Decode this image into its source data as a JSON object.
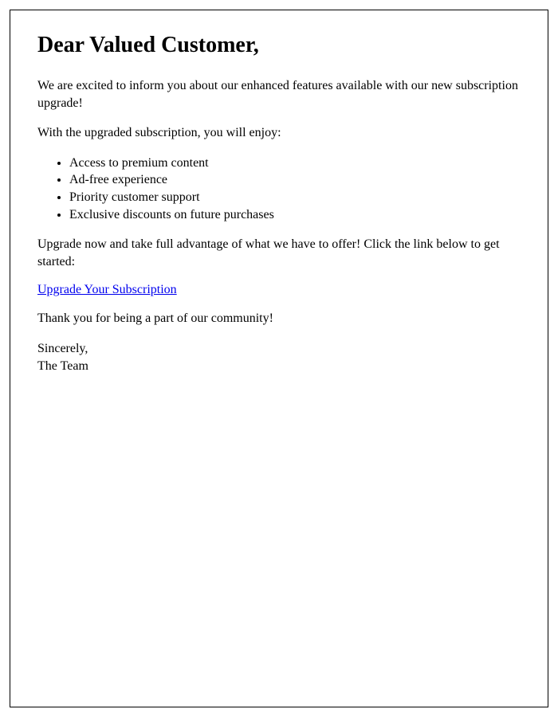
{
  "heading": "Dear Valued Customer,",
  "intro": "We are excited to inform you about our enhanced features available with our new subscription upgrade!",
  "benefits_lead": "With the upgraded subscription, you will enjoy:",
  "benefits": [
    "Access to premium content",
    "Ad-free experience",
    "Priority customer support",
    "Exclusive discounts on future purchases"
  ],
  "cta_text": "Upgrade now and take full advantage of what we have to offer! Click the link below to get started:",
  "cta_link_label": "Upgrade Your Subscription",
  "thanks": "Thank you for being a part of our community!",
  "signoff_line1": "Sincerely,",
  "signoff_line2": "The Team"
}
